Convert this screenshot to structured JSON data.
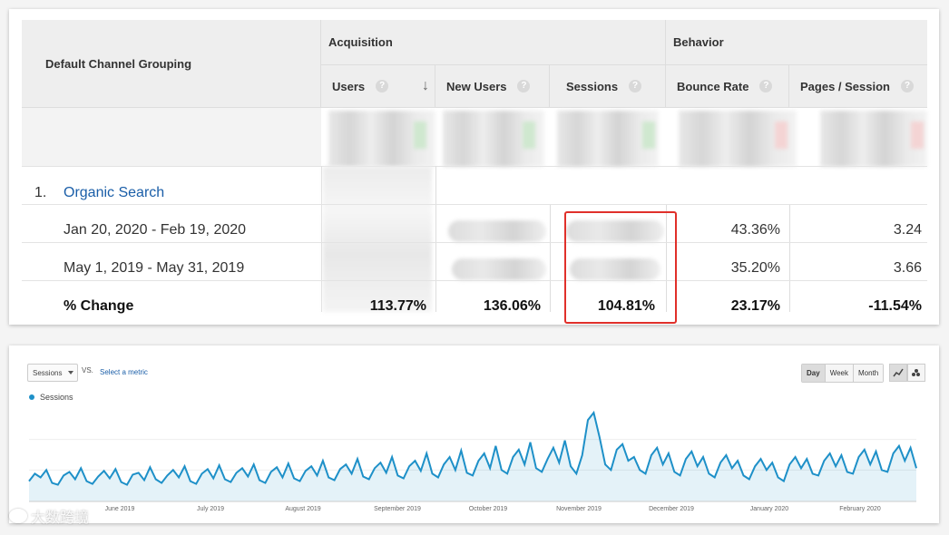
{
  "table": {
    "dimension_header": "Default Channel Grouping",
    "groups": {
      "acquisition": "Acquisition",
      "behavior": "Behavior"
    },
    "columns": {
      "users": "Users",
      "new_users": "New Users",
      "sessions": "Sessions",
      "bounce_rate": "Bounce Rate",
      "pages_session": "Pages / Session"
    },
    "help_icon": "?",
    "sort_icon": "↓",
    "segment": {
      "index": "1.",
      "name": "Organic Search"
    },
    "rows": [
      {
        "label": "Jan 20, 2020 - Feb 19, 2020",
        "bounce_rate": "43.36%",
        "pages_session": "3.24"
      },
      {
        "label": "May 1, 2019 - May 31, 2019",
        "bounce_rate": "35.20%",
        "pages_session": "3.66"
      }
    ],
    "change_row": {
      "label": "% Change",
      "users": "113.77%",
      "new_users": "136.06%",
      "sessions": "104.81%",
      "bounce_rate": "23.17%",
      "pages_session": "-11.54%"
    }
  },
  "chart_panel": {
    "metric_select": "Sessions",
    "vs_label": "VS.",
    "select_metric_link": "Select a metric",
    "legend_label": "Sessions",
    "period_buttons": [
      "Day",
      "Week",
      "Month"
    ],
    "active_period": "Day",
    "icons": [
      "line-chart-icon",
      "motion-chart-icon"
    ]
  },
  "chart_data": {
    "type": "area",
    "series": [
      {
        "name": "Sessions",
        "values": [
          22,
          30,
          26,
          34,
          20,
          18,
          28,
          32,
          24,
          36,
          22,
          19,
          27,
          33,
          25,
          35,
          21,
          18,
          29,
          31,
          23,
          37,
          24,
          20,
          28,
          34,
          26,
          38,
          22,
          19,
          30,
          35,
          25,
          39,
          24,
          21,
          31,
          36,
          27,
          40,
          23,
          20,
          32,
          37,
          26,
          41,
          25,
          22,
          33,
          38,
          28,
          44,
          26,
          23,
          35,
          40,
          30,
          46,
          27,
          24,
          36,
          42,
          31,
          48,
          28,
          25,
          38,
          44,
          33,
          52,
          30,
          26,
          40,
          48,
          34,
          55,
          31,
          28,
          44,
          52,
          36,
          60,
          34,
          30,
          48,
          56,
          40,
          64,
          36,
          32,
          46,
          58,
          42,
          66,
          38,
          30,
          50,
          88,
          96,
          70,
          40,
          34,
          56,
          62,
          44,
          48,
          34,
          30,
          50,
          58,
          40,
          52,
          32,
          28,
          46,
          54,
          38,
          48,
          30,
          26,
          42,
          50,
          36,
          44,
          28,
          24,
          38,
          46,
          34,
          42,
          26,
          22,
          40,
          48,
          36,
          46,
          30,
          28,
          44,
          52,
          38,
          50,
          32,
          30,
          48,
          56,
          40,
          54,
          34,
          32,
          52,
          60,
          44,
          58,
          36
        ]
      }
    ],
    "x_labels": [
      "June 2019",
      "July 2019",
      "August 2019",
      "September 2019",
      "October 2019",
      "November 2019",
      "December 2019",
      "January 2020",
      "February 2020"
    ],
    "color": "#1e90c8"
  },
  "watermark": {
    "text": "大数跨境"
  }
}
